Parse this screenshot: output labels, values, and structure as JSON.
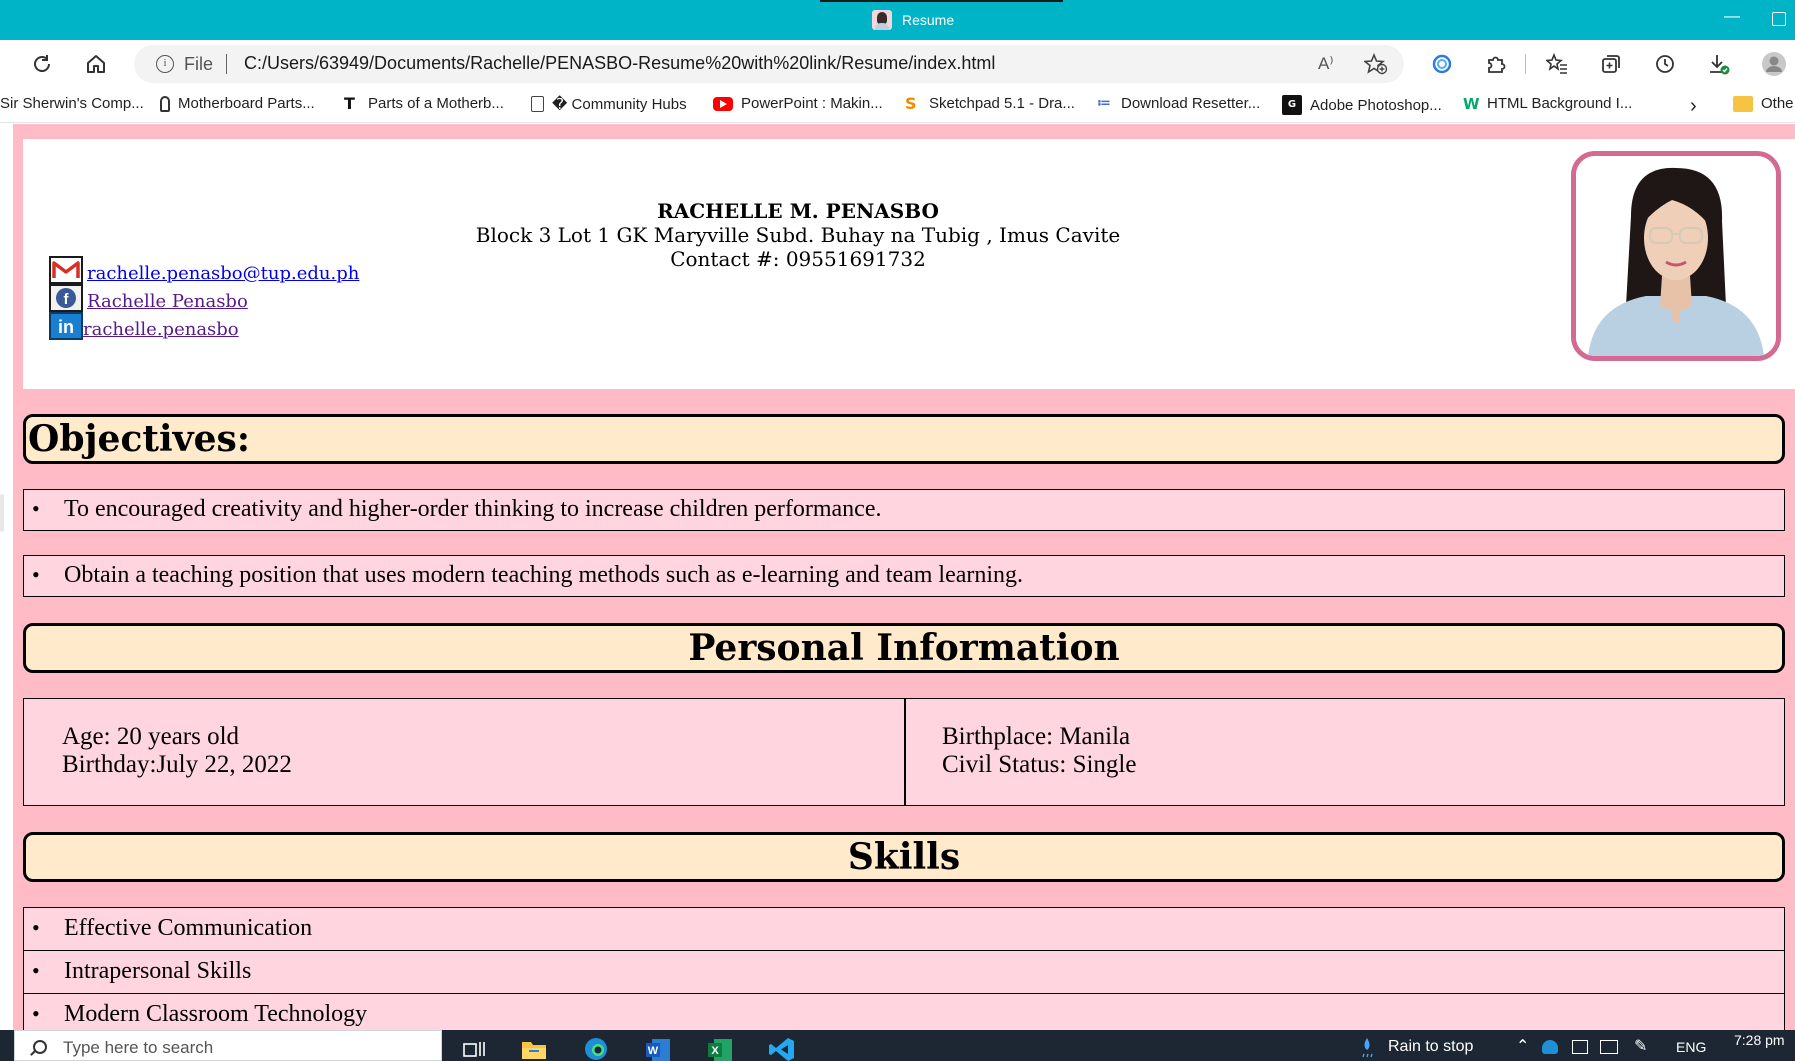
{
  "browser": {
    "tab_title": "Resume",
    "file_label": "File",
    "url": "C:/Users/63949/Documents/Rachelle/PENASBO-Resume%20with%20link/Resume/index.html",
    "read_aloud_label": "A⁾"
  },
  "bookmarks": [
    {
      "label": "Sir Sherwin's Comp...",
      "icon": "none"
    },
    {
      "label": "Motherboard Parts...",
      "icon": "motherboard-icon"
    },
    {
      "label": "Parts of a Motherb...",
      "icon": "t-logo-icon"
    },
    {
      "label": "� Community Hubs",
      "icon": "page-icon"
    },
    {
      "label": "PowerPoint : Makin...",
      "icon": "youtube-icon"
    },
    {
      "label": "Sketchpad 5.1 - Dra...",
      "icon": "sketchpad-icon"
    },
    {
      "label": "Download Resetter...",
      "icon": "resetter-icon"
    },
    {
      "label": "Adobe Photoshop...",
      "icon": "gf-icon"
    },
    {
      "label": "HTML Background I...",
      "icon": "w3-icon"
    },
    {
      "label": "Othe",
      "icon": "folder-icon"
    }
  ],
  "resume": {
    "name": "RACHELLE M. PENASBO",
    "address": "Block 3 Lot 1 GK Maryville Subd. Buhay na Tubig , Imus Cavite",
    "contact": "Contact #: 09551691732",
    "email_link": "rachelle.penasbo@tup.edu.ph",
    "facebook_link": "Rachelle Penasbo",
    "linkedin_link": "rachelle.penasbo",
    "objectives_title": "Objectives:",
    "objectives": [
      "To encouraged creativity and higher-order thinking to increase children performance.",
      "Obtain a teaching position that uses modern teaching methods such as e-learning and team learning."
    ],
    "personal_title": "Personal Information",
    "personal": {
      "age": "Age: 20 years old",
      "birthday": "Birthday:July 22, 2022",
      "birthplace": "Birthplace: Manila",
      "civil_status": "Civil Status: Single"
    },
    "skills_title": "Skills",
    "skills": [
      "Effective Communication",
      "Intrapersonal Skills",
      "Modern Classroom Technology"
    ],
    "bullet": "•"
  },
  "taskbar": {
    "search_placeholder": "Type here to search",
    "weather": "Rain to stop",
    "language": "ENG",
    "time": "7:28 pm"
  },
  "colors": {
    "chrome_teal": "#00b4c8",
    "page_pink": "#ffbcc7",
    "box_pink": "#ffd6e0",
    "section_cream": "#ffeacc",
    "photo_border": "#d46a92"
  }
}
